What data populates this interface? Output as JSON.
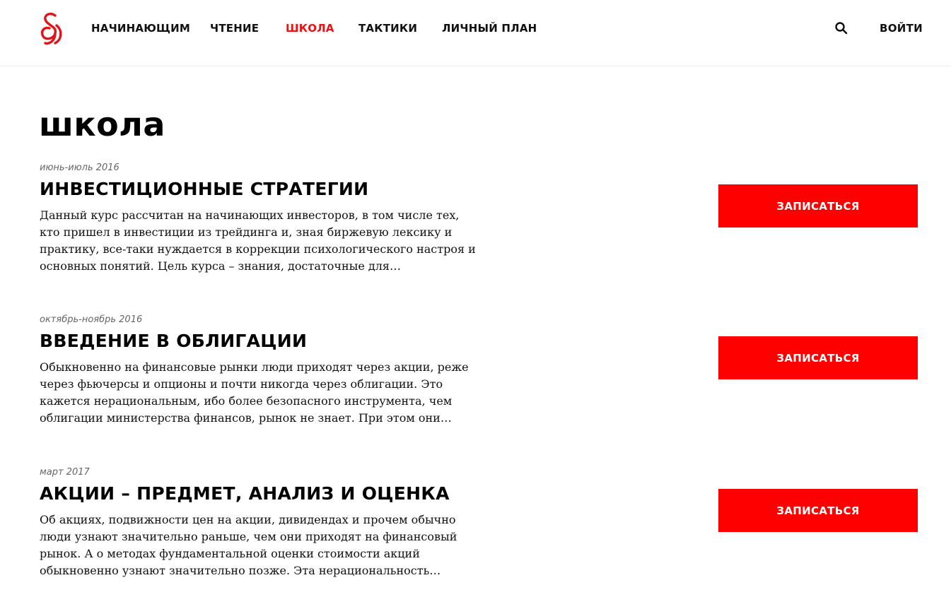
{
  "header": {
    "nav": [
      {
        "label": "НАЧИНАЮЩИМ",
        "active": false
      },
      {
        "label": "ЧТЕНИЕ",
        "active": false
      },
      {
        "label": "ШКОЛА",
        "active": true
      },
      {
        "label": "ТАКТИКИ",
        "active": false
      },
      {
        "label": "ЛИЧНЫЙ ПЛАН",
        "active": false
      }
    ],
    "login_label": "ВОЙТИ",
    "search_icon": "search-icon",
    "logo_icon": "logo-icon"
  },
  "colors": {
    "accent": "#ff0000",
    "active_nav": "#ee1111",
    "text": "#111111",
    "date": "#666666"
  },
  "page": {
    "title": "школа"
  },
  "courses": [
    {
      "date": "июнь-июль 2016",
      "title": "ИНВЕСТИЦИОННЫЕ СТРАТЕГИИ",
      "description": "Данный курс рассчитан на начинающих инвесторов, в том числе тех, кто пришел в инвестиции из трейдинга и, зная биржевую лексику и практику, все-таки нуждается в коррекции психологического настроя и основных понятий. Цель курса – знания, достаточные для…",
      "button_label": "ЗАПИСАТЬСЯ"
    },
    {
      "date": "октябрь-ноябрь 2016",
      "title": "ВВЕДЕНИЕ В ОБЛИГАЦИИ",
      "description": "Обыкновенно на финансовые рынки люди приходят через акции, реже через фьючерсы и опционы и почти никогда через облигации. Это кажется нерациональным, ибо более безопасного инструмента, чем облигации министерства финансов, рынок не знает. При этом они…",
      "button_label": "ЗАПИСАТЬСЯ"
    },
    {
      "date": "март 2017",
      "title": "АКЦИИ – ПРЕДМЕТ, АНАЛИЗ И ОЦЕНКА",
      "description": "Об акциях, подвижности цен на акции, дивидендах и прочем обычно люди узнают значительно раньше, чем они приходят на финансовый рынок. А о методах фундаментальной оценки стоимости акций обыкновенно узнают значительно позже. Эта нерациональность…",
      "button_label": "ЗАПИСАТЬСЯ"
    }
  ]
}
